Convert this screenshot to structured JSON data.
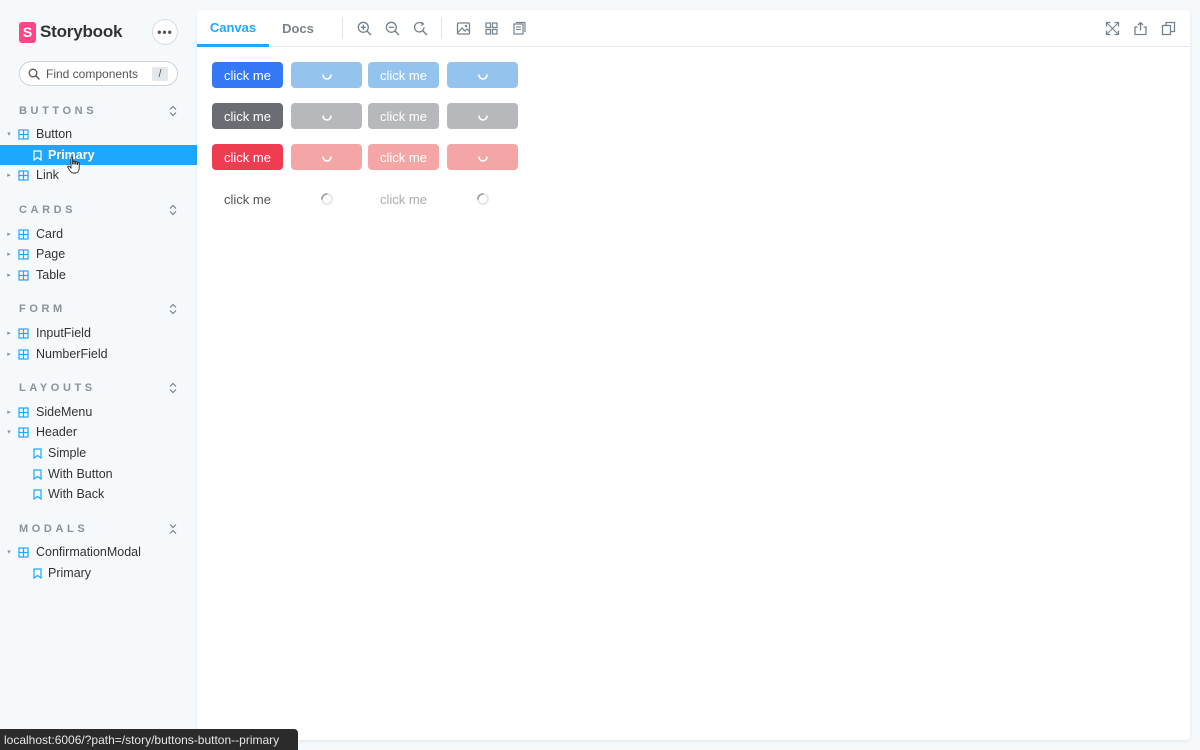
{
  "brand": {
    "name": "Storybook",
    "logo_letter": "S",
    "color": "#ff4785"
  },
  "menu": {
    "icon": "ellipsis-icon",
    "glyph": "•••"
  },
  "search": {
    "placeholder": "Find components",
    "shortcut": "/"
  },
  "sidebar": {
    "accent": "#1ea7fd",
    "sections": [
      {
        "title": "BUTTONS",
        "toggle": "⌃⌄"
      },
      {
        "title": "CARDS",
        "toggle": "⌃⌄"
      },
      {
        "title": "FORM",
        "toggle": "⌃⌄"
      },
      {
        "title": "LAYOUTS",
        "toggle": "⌃⌄"
      },
      {
        "title": "MODALS",
        "toggle": "✕"
      }
    ],
    "items": {
      "button": "Button",
      "button_primary": "Primary",
      "link": "Link",
      "card": "Card",
      "page": "Page",
      "table": "Table",
      "inputfield": "InputField",
      "numberfield": "NumberField",
      "sidemenu": "SideMenu",
      "header": "Header",
      "header_simple": "Simple",
      "header_with_button": "With Button",
      "header_with_back": "With Back",
      "confirmationmodal": "ConfirmationModal",
      "confirmationmodal_primary": "Primary"
    }
  },
  "toolbar": {
    "tabs": [
      {
        "label": "Canvas",
        "active": true
      },
      {
        "label": "Docs",
        "active": false
      }
    ],
    "icons": [
      "zoom-in-icon",
      "zoom-out-icon",
      "zoom-reset-icon",
      "background-icon",
      "grid-icon",
      "outline-icon",
      "fullscreen-icon",
      "share-icon",
      "copy-link-icon"
    ]
  },
  "canvas": {
    "label": "click me",
    "colors": {
      "primary": "#3578f6",
      "primary_light": "#94c4ee",
      "secondary": "#6b6d72",
      "secondary_light": "#b7b8bb",
      "danger": "#ee3d50",
      "danger_light": "#f4a6a6",
      "text": "#555555",
      "text_light": "#a8abb0"
    }
  },
  "status": {
    "url": "localhost:6006/?path=/story/buttons-button--primary"
  }
}
